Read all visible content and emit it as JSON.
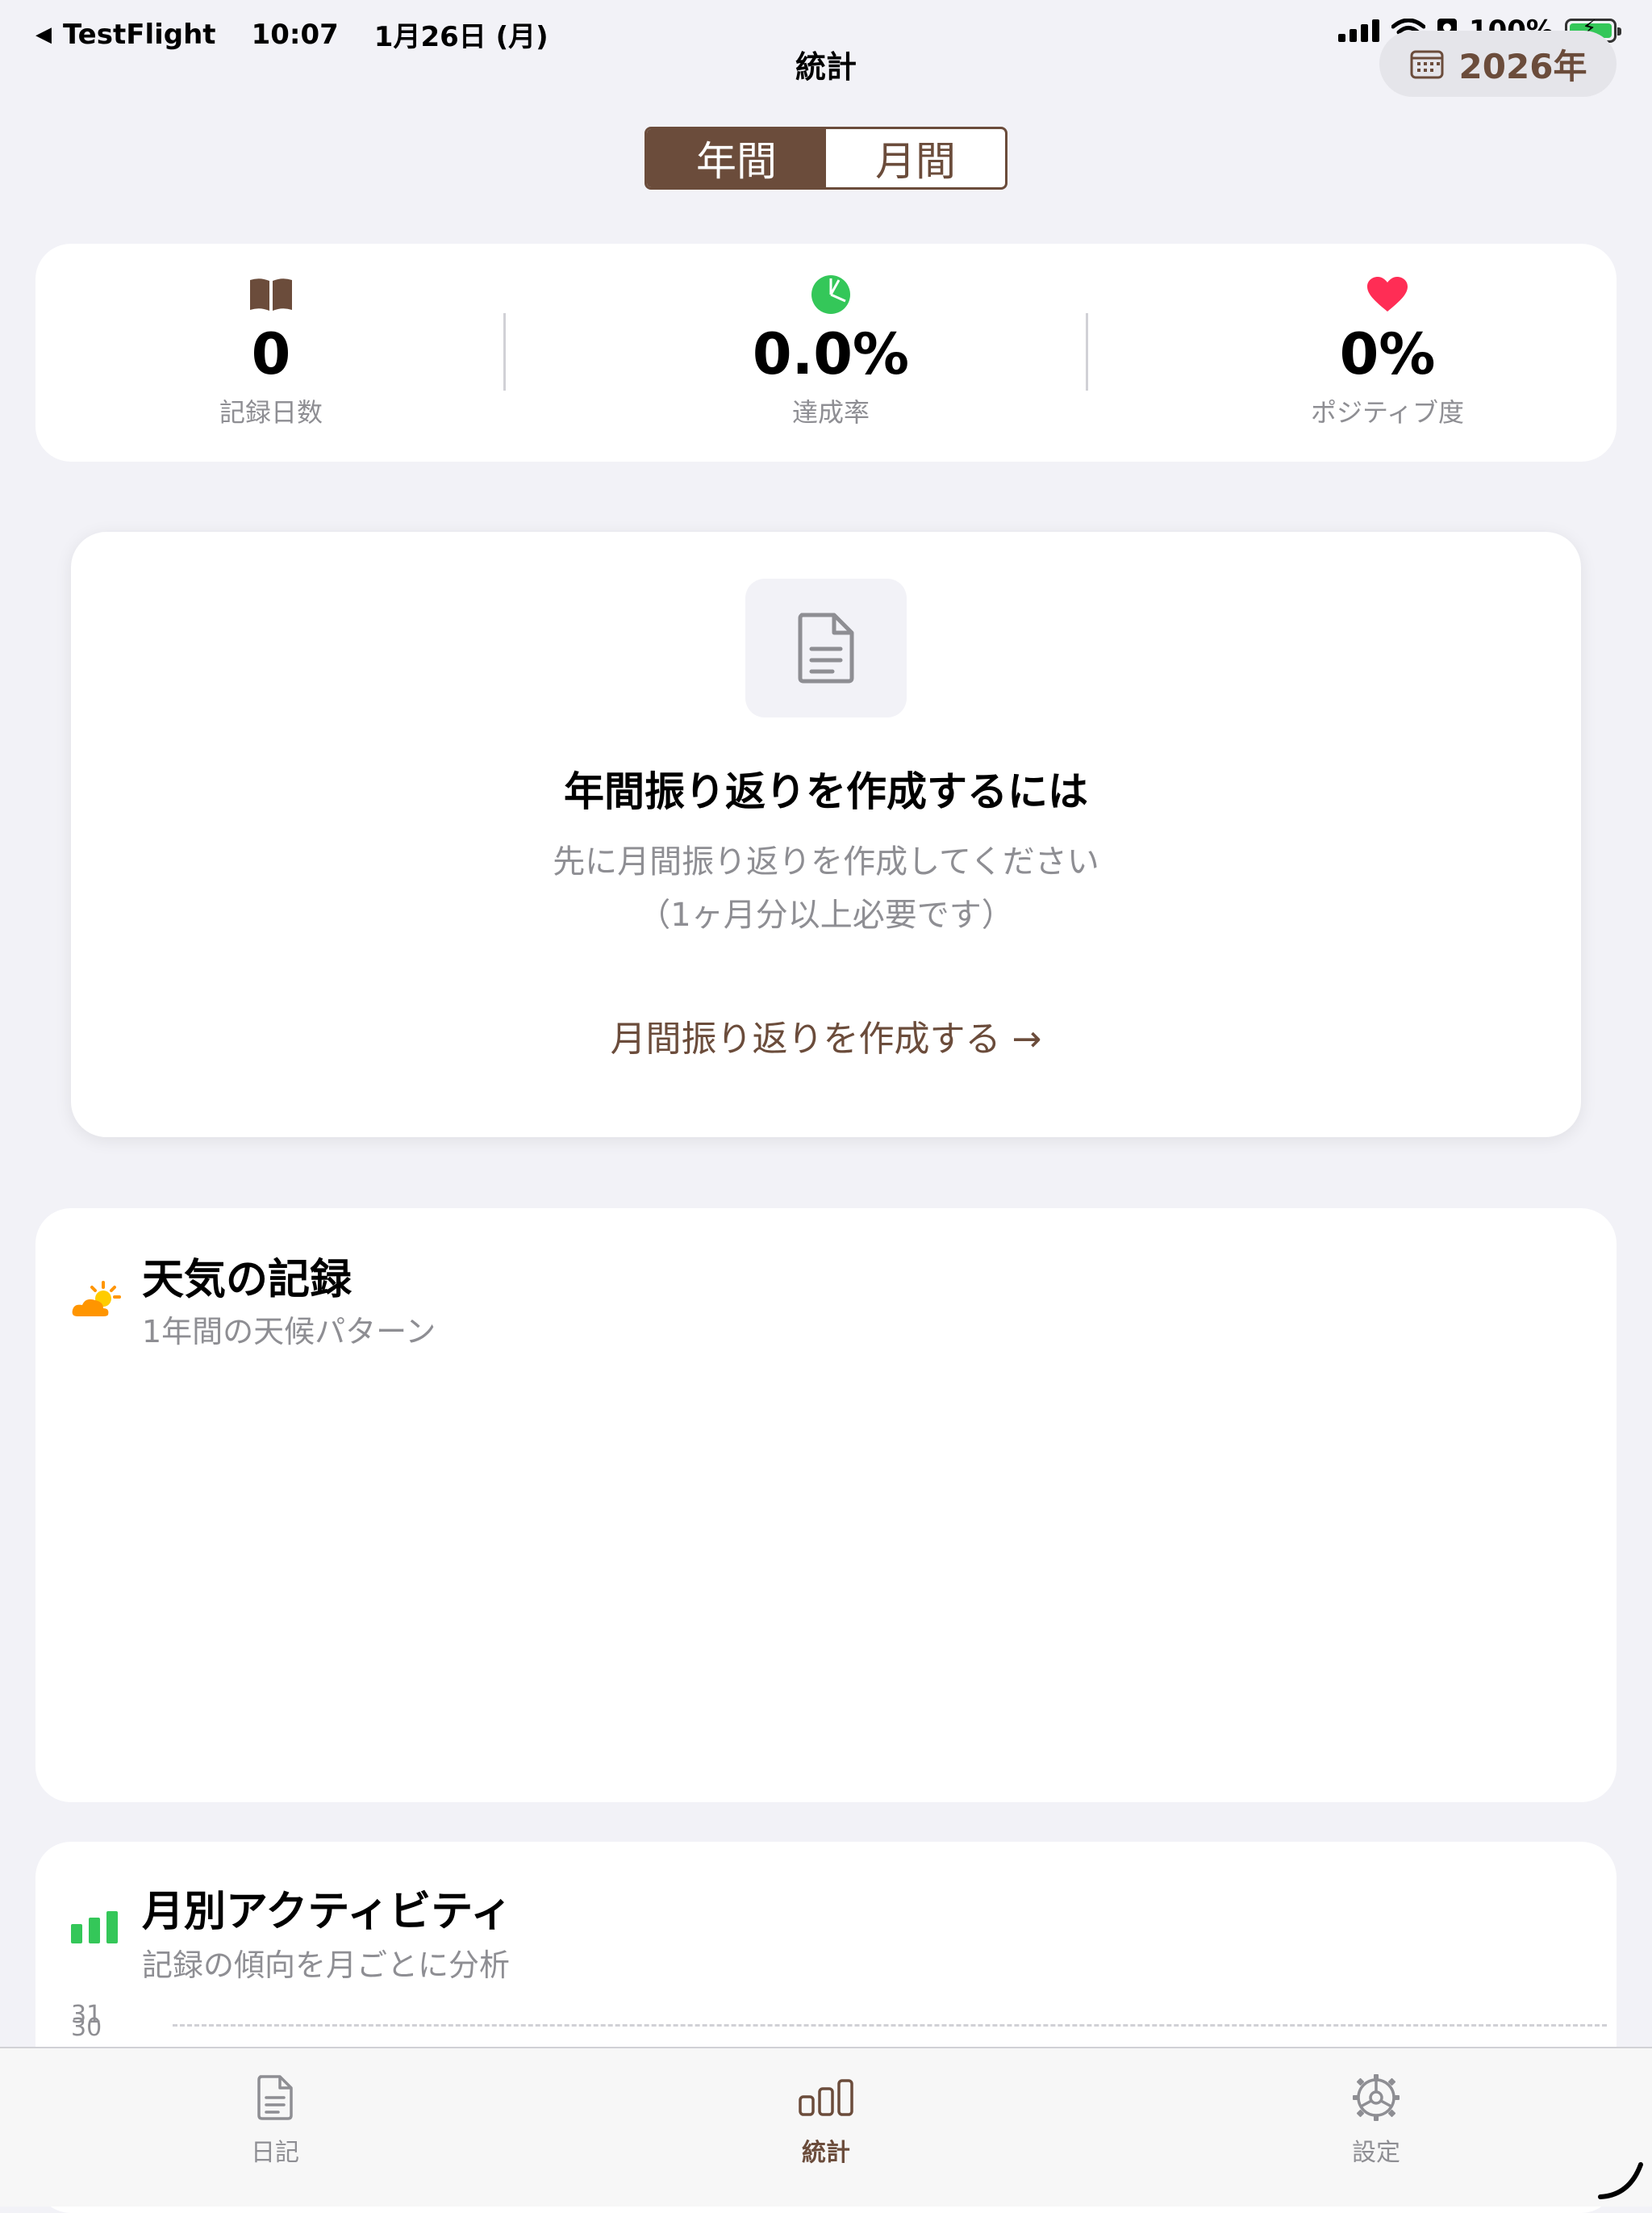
{
  "status_bar": {
    "back_app": "TestFlight",
    "time": "10:07",
    "date": "1月26日 (月)",
    "battery": "100%",
    "battery_level": 1.0
  },
  "nav": {
    "title": "統計",
    "year_button": "2026年"
  },
  "segmented": {
    "options": [
      "年間",
      "月間"
    ],
    "selected": 0
  },
  "summary": {
    "metrics": [
      {
        "icon": "book-icon",
        "value": "0",
        "label": "記録日数"
      },
      {
        "icon": "pie-chart-icon",
        "value": "0.0%",
        "label": "達成率"
      },
      {
        "icon": "heart-icon",
        "value": "0%",
        "label": "ポジティブ度"
      }
    ]
  },
  "annual_cta": {
    "icon": "document-icon",
    "title": "年間振り返りを作成するには",
    "subtitle_line1": "先に月間振り返りを作成してください",
    "subtitle_line2": "（1ヶ月分以上必要です）",
    "link": "月間振り返りを作成する →"
  },
  "weather": {
    "icon": "cloud-sun-icon",
    "title": "天気の記録",
    "subtitle": "1年間の天候パターン"
  },
  "activity": {
    "icon": "bar-chart-icon",
    "title": "月別アクティビティ",
    "subtitle": "記録の傾向を月ごとに分析",
    "y_ticks": [
      "31",
      "30"
    ]
  },
  "tabbar": {
    "tabs": [
      {
        "icon": "document-icon",
        "label": "日記"
      },
      {
        "icon": "bar-chart-icon",
        "label": "統計"
      },
      {
        "icon": "gear-icon",
        "label": "設定"
      }
    ],
    "selected": 1
  },
  "colors": {
    "brand": "#6b4c3b",
    "green": "#34c759",
    "red": "#ff2d55",
    "orange": "#ff9500",
    "background": "#f2f2f7"
  }
}
